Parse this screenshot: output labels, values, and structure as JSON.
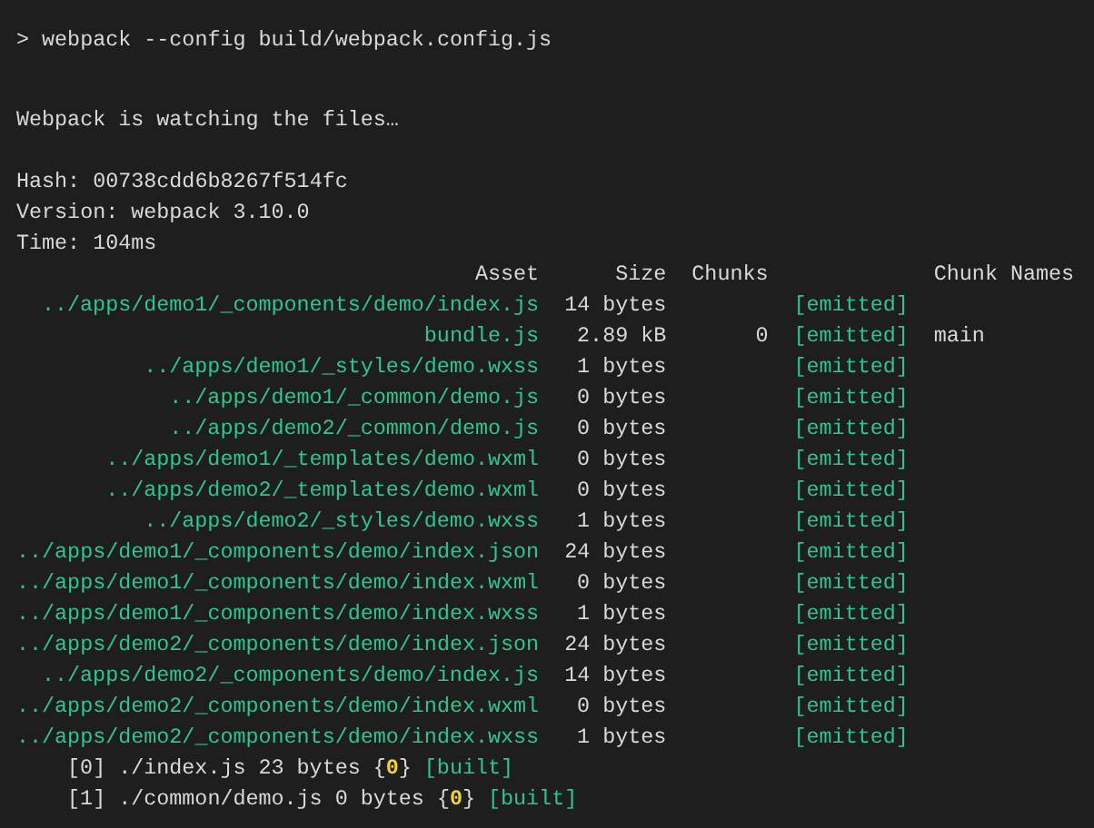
{
  "command": "> webpack --config build/webpack.config.js",
  "status": "Webpack is watching the files…",
  "stats": [
    "Hash: 00738cdd6b8267f514fc",
    "Version: webpack 3.10.0",
    "Time: 104ms"
  ],
  "table": {
    "columns": [
      "Asset",
      "Size",
      "Chunks",
      null,
      "Chunk Names"
    ],
    "rows": [
      {
        "asset": "../apps/demo1/_components/demo/index.js",
        "size": "14 bytes",
        "status": "[emitted]"
      },
      {
        "asset": "bundle.js",
        "size": "2.89 kB",
        "chunks": "0",
        "status": "[emitted]",
        "chunk_names": "main"
      },
      {
        "asset": "../apps/demo1/_styles/demo.wxss",
        "size": "1 bytes",
        "status": "[emitted]"
      },
      {
        "asset": "../apps/demo1/_common/demo.js",
        "size": "0 bytes",
        "status": "[emitted]"
      },
      {
        "asset": "../apps/demo2/_common/demo.js",
        "size": "0 bytes",
        "status": "[emitted]"
      },
      {
        "asset": "../apps/demo1/_templates/demo.wxml",
        "size": "0 bytes",
        "status": "[emitted]"
      },
      {
        "asset": "../apps/demo2/_templates/demo.wxml",
        "size": "0 bytes",
        "status": "[emitted]"
      },
      {
        "asset": "../apps/demo2/_styles/demo.wxss",
        "size": "1 bytes",
        "status": "[emitted]"
      },
      {
        "asset": "../apps/demo1/_components/demo/index.json",
        "size": "24 bytes",
        "status": "[emitted]"
      },
      {
        "asset": "../apps/demo1/_components/demo/index.wxml",
        "size": "0 bytes",
        "status": "[emitted]"
      },
      {
        "asset": "../apps/demo1/_components/demo/index.wxss",
        "size": "1 bytes",
        "status": "[emitted]"
      },
      {
        "asset": "../apps/demo2/_components/demo/index.json",
        "size": "24 bytes",
        "status": "[emitted]"
      },
      {
        "asset": "../apps/demo2/_components/demo/index.js",
        "size": "14 bytes",
        "status": "[emitted]"
      },
      {
        "asset": "../apps/demo2/_components/demo/index.wxml",
        "size": "0 bytes",
        "status": "[emitted]"
      },
      {
        "asset": "../apps/demo2/_components/demo/index.wxss",
        "size": "1 bytes",
        "status": "[emitted]"
      }
    ]
  },
  "modules": [
    {
      "parts": [
        {
          "kind": "plain",
          "text": "[0] ./index.js 23 bytes {"
        },
        {
          "kind": "chunk",
          "text": "0"
        },
        {
          "kind": "plain",
          "text": "}"
        },
        {
          "kind": "flag",
          "text": "[built]"
        }
      ]
    },
    {
      "parts": [
        {
          "kind": "plain",
          "text": "[1] ./common/demo.js 0 bytes {"
        },
        {
          "kind": "chunk",
          "text": "0"
        },
        {
          "kind": "plain",
          "text": "}"
        },
        {
          "kind": "flag",
          "text": "[built]"
        }
      ]
    }
  ]
}
